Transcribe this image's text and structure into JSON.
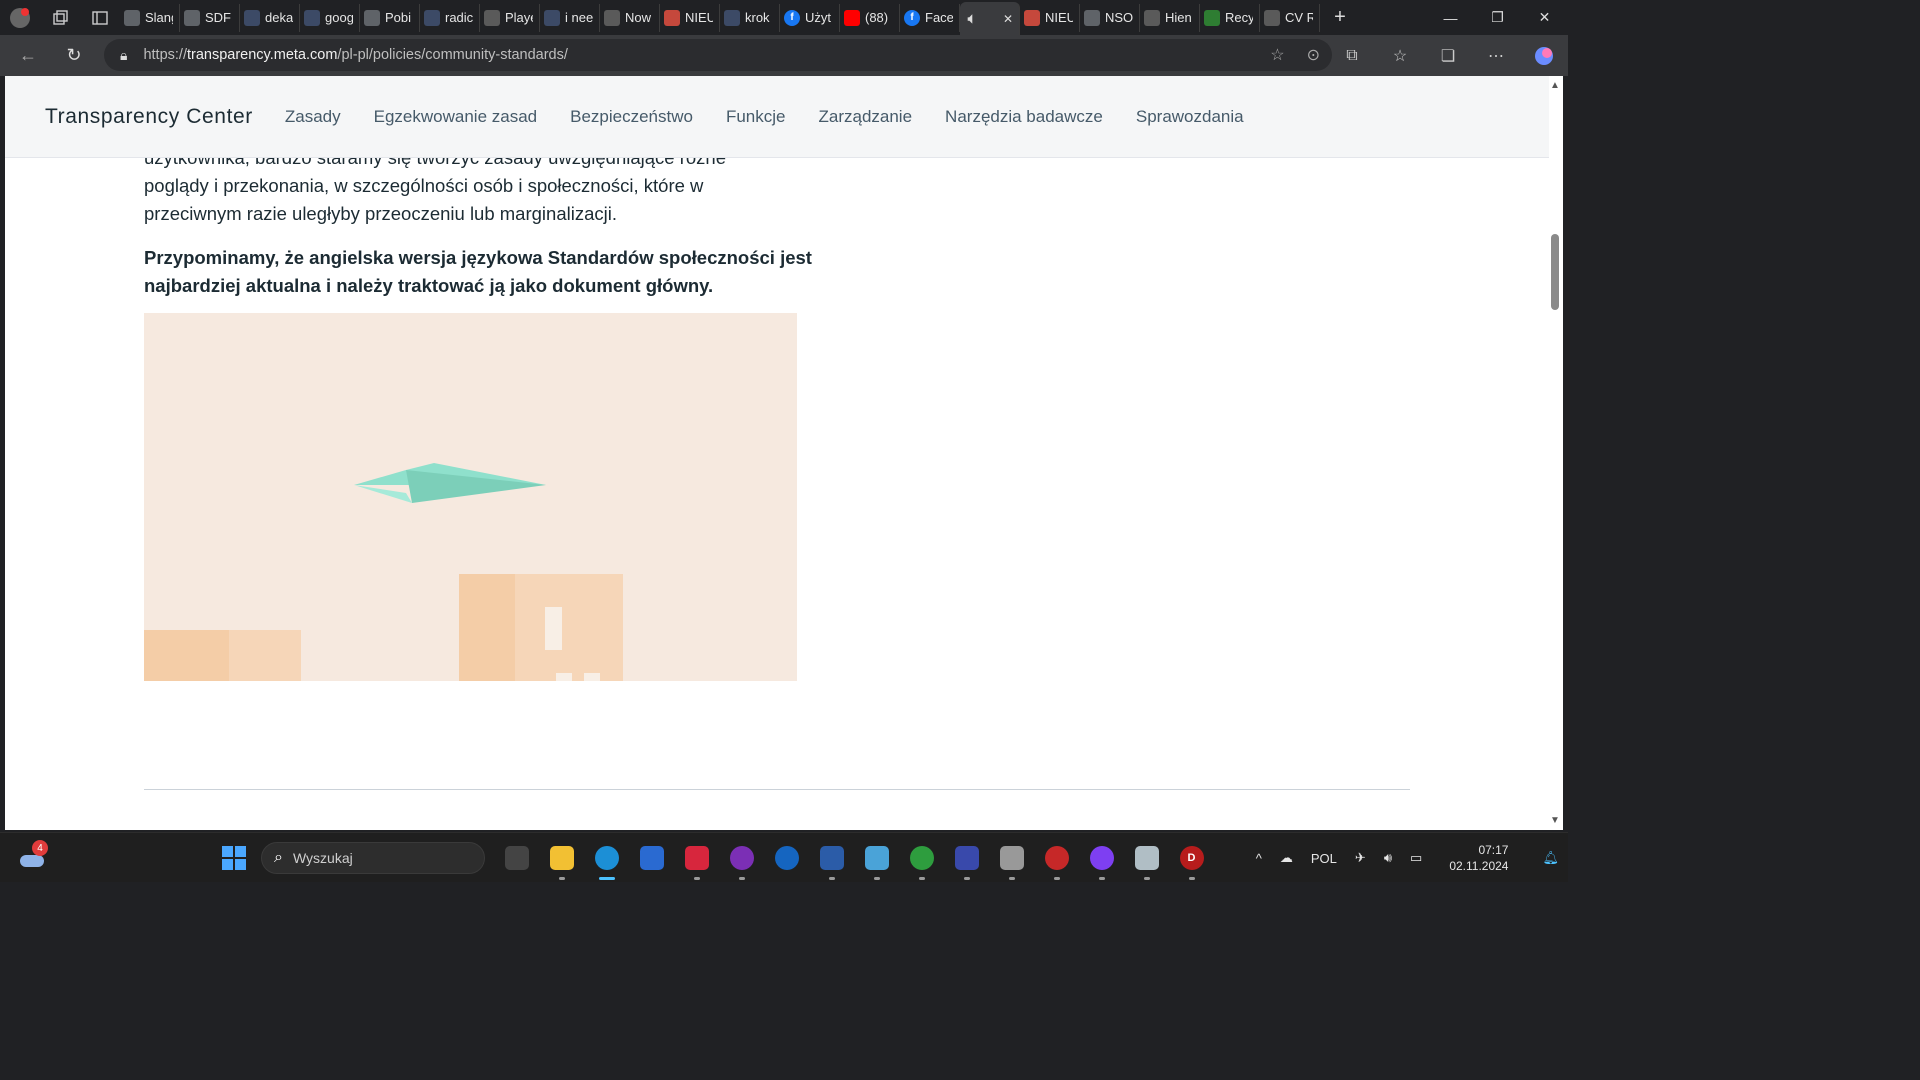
{
  "tabs": [
    {
      "label": "Slang",
      "icon": "globe-icon"
    },
    {
      "label": "SDF",
      "icon": "globe-icon"
    },
    {
      "label": "deka",
      "icon": "search-icon"
    },
    {
      "label": "goog",
      "icon": "search-icon"
    },
    {
      "label": "Pobi",
      "icon": "globe-icon"
    },
    {
      "label": "radic",
      "icon": "search-icon"
    },
    {
      "label": "Playe",
      "icon": "document-icon"
    },
    {
      "label": "i nee",
      "icon": "search-icon"
    },
    {
      "label": "Now",
      "icon": "document-icon"
    },
    {
      "label": "NIEU",
      "icon": "map-pin-icon"
    },
    {
      "label": "krok",
      "icon": "search-icon"
    },
    {
      "label": "Użyt",
      "icon": "facebook-icon"
    },
    {
      "label": "(88)",
      "icon": "youtube-icon"
    },
    {
      "label": "Face",
      "icon": "facebook-icon"
    },
    {
      "label": "",
      "icon": "speaker-icon",
      "active": true
    },
    {
      "label": "NIEU",
      "icon": "map-pin-icon"
    },
    {
      "label": "NSO",
      "icon": "globe-icon"
    },
    {
      "label": "Hien",
      "icon": "document-icon"
    },
    {
      "label": "Recy",
      "icon": "leaf-icon"
    },
    {
      "label": "CV R",
      "icon": "document-icon"
    }
  ],
  "addressbar": {
    "url_prefix": "https://",
    "url_domain": "transparency.meta.com",
    "url_path": "/pl-pl/policies/community-standards/"
  },
  "site": {
    "brand": "Transparency Center",
    "nav": [
      "Zasady",
      "Egzekwowanie zasad",
      "Bezpieczeństwo",
      "Funkcje",
      "Zarządzanie",
      "Narzędzia badawcze",
      "Sprawozdania"
    ]
  },
  "content": {
    "para1_line0": "użytkownika, bardzo staramy się tworzyć zasady uwzględniające różne",
    "para1_line1": "poglądy i przekonania, w szczególności osób i społeczności, które w",
    "para1_line2": "przeciwnym razie uległyby przeoczeniu lub marginalizacji.",
    "notice": "Przypominamy, że angielska wersja językowa Standardów społeczności jest najbardziej aktualna i należy traktować ją jako dokument główny."
  },
  "taskbar": {
    "weather_badge": "4",
    "search_placeholder": "Wyszukaj",
    "language": "POL",
    "time": "07:17",
    "date": "02.11.2024"
  },
  "colors": {
    "page_bg": "#ffffff",
    "nav_bg": "#f5f6f7",
    "text": "#1c2b33",
    "illustration_bg": "#f6e9df",
    "plane": "#8fe0cc"
  }
}
